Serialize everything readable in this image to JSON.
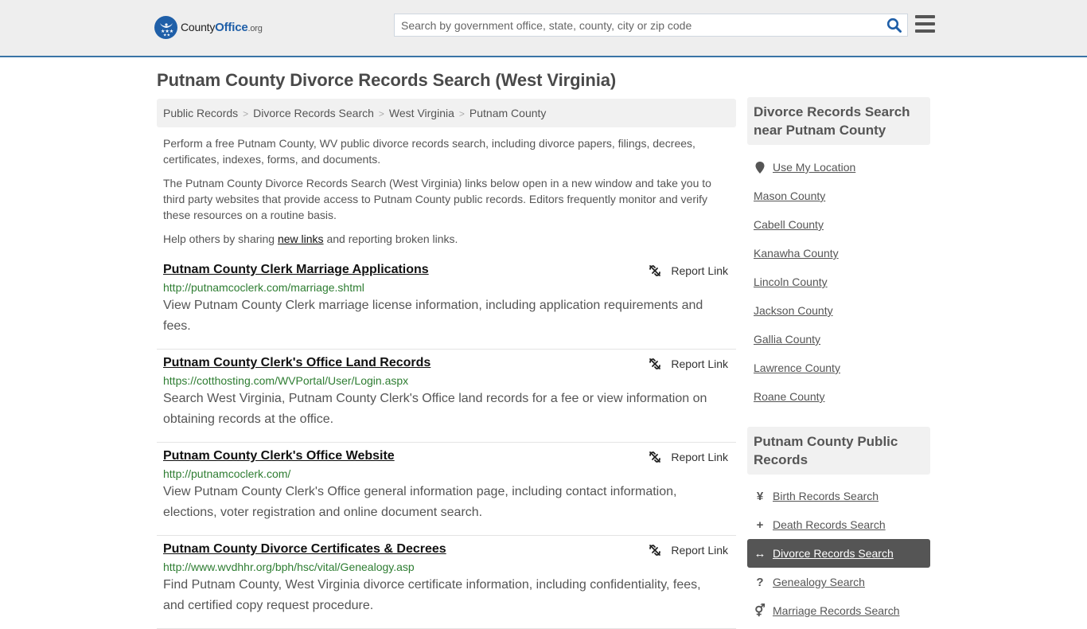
{
  "header": {
    "logo": {
      "name_part1": "County",
      "name_part2": "Office",
      "name_suffix": ".org"
    },
    "search": {
      "placeholder": "Search by government office, state, county, city or zip code",
      "value": "",
      "icon": "search-icon"
    },
    "menu_icon": "hamburger-menu-icon"
  },
  "page": {
    "title": "Putnam County Divorce Records Search (West Virginia)",
    "breadcrumb": [
      {
        "label": "Public Records"
      },
      {
        "label": "Divorce Records Search"
      },
      {
        "label": "West Virginia"
      },
      {
        "label": "Putnam County"
      }
    ],
    "intro": {
      "p1": "Perform a free Putnam County, WV public divorce records search, including divorce papers, filings, decrees, certificates, indexes, forms, and documents.",
      "p2": "The Putnam County Divorce Records Search (West Virginia) links below open in a new window and take you to third party websites that provide access to Putnam County public records. Editors frequently monitor and verify these resources on a routine basis.",
      "p3_before": "Help others by sharing ",
      "p3_link": "new links",
      "p3_after": " and reporting broken links."
    },
    "report_label": "Report Link",
    "results": [
      {
        "title": "Putnam County Clerk Marriage Applications",
        "url": "http://putnamcoclerk.com/marriage.shtml",
        "description": "View Putnam County Clerk marriage license information, including application requirements and fees."
      },
      {
        "title": "Putnam County Clerk's Office Land Records",
        "url": "https://cotthosting.com/WVPortal/User/Login.aspx",
        "description": "Search West Virginia, Putnam County Clerk's Office land records for a fee or view information on obtaining records at the office."
      },
      {
        "title": "Putnam County Clerk's Office Website",
        "url": "http://putnamcoclerk.com/",
        "description": "View Putnam County Clerk's Office general information page, including contact information, elections, voter registration and online document search."
      },
      {
        "title": "Putnam County Divorce Certificates & Decrees",
        "url": "http://www.wvdhhr.org/bph/hsc/vital/Genealogy.asp",
        "description": "Find Putnam County, West Virginia divorce certificate information, including confidentiality, fees, and certified copy request procedure."
      }
    ]
  },
  "sidebar": {
    "nearby": {
      "heading": "Divorce Records Search near Putnam County",
      "use_location": "Use My Location",
      "counties": [
        "Mason County",
        "Cabell County",
        "Kanawha County",
        "Lincoln County",
        "Jackson County",
        "Gallia County",
        "Lawrence County",
        "Roane County"
      ]
    },
    "public_records": {
      "heading": "Putnam County Public Records",
      "items": [
        {
          "label": "Birth Records Search",
          "icon": "child-icon",
          "glyph": "¥",
          "active": false
        },
        {
          "label": "Death Records Search",
          "icon": "plus-icon",
          "glyph": "+",
          "active": false
        },
        {
          "label": "Divorce Records Search",
          "icon": "arrows-horizontal-icon",
          "glyph": "↔",
          "active": true
        },
        {
          "label": "Genealogy Search",
          "icon": "question-icon",
          "glyph": "?",
          "active": false
        },
        {
          "label": "Marriage Records Search",
          "icon": "marriage-symbol-icon",
          "glyph": "⚥",
          "active": false
        }
      ]
    }
  },
  "colors": {
    "brand_blue": "#1f5fa8",
    "header_border": "#3a74a6",
    "url_green": "#2e7d32",
    "active_item_bg": "#555555"
  }
}
